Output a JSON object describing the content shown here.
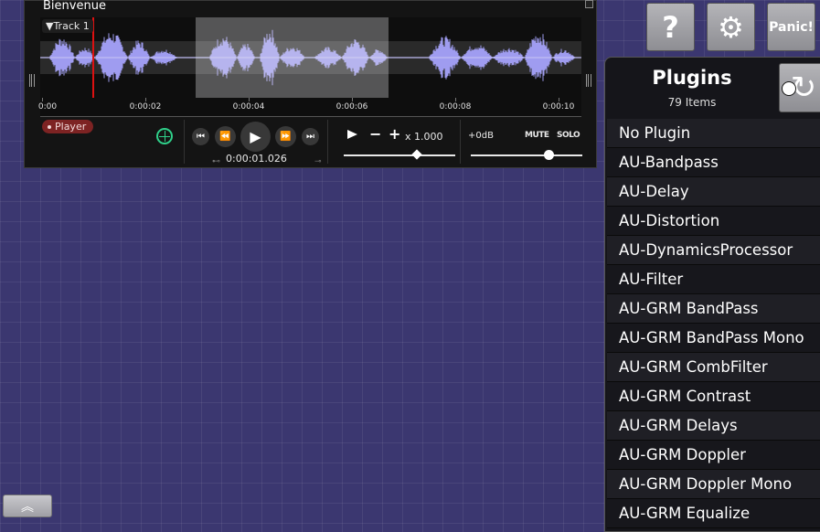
{
  "player": {
    "title": "Bienvenue",
    "track_label": "▼Track 1",
    "badge_label": "Player",
    "time_ticks": [
      "0:00",
      "0:00:02",
      "0:00:04",
      "0:00:06",
      "0:00:08",
      "0:00:10"
    ],
    "position_readout": "0:00:01.026",
    "speed": "x 1.000",
    "gain": "+0dB",
    "mute_label": "MUTE",
    "solo_label": "SOLO"
  },
  "toolbar": {
    "help_label": "?",
    "settings_icon": "gear-icon",
    "panic_label": "Panic!"
  },
  "plugins": {
    "title": "Plugins",
    "count": "79 Items",
    "refresh_icon": "refresh-icon",
    "items": [
      "No Plugin",
      "AU-Bandpass",
      "AU-Delay",
      "AU-Distortion",
      "AU-DynamicsProcessor",
      "AU-Filter",
      "AU-GRM BandPass",
      "AU-GRM BandPass Mono",
      "AU-GRM CombFilter",
      "AU-GRM Contrast",
      "AU-GRM Delays",
      "AU-GRM Doppler",
      "AU-GRM Doppler Mono",
      "AU-GRM Equalize"
    ]
  },
  "colors": {
    "background": "#3b3770",
    "waveform": "#9f9cf0",
    "playhead": "#dd1111",
    "player_badge": "#7d2323",
    "sync_accent": "#2fd08a"
  }
}
